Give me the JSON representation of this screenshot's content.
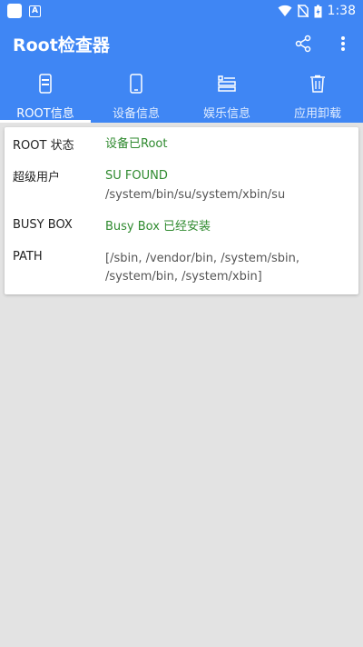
{
  "status_bar": {
    "time": "1:38"
  },
  "app": {
    "title": "Root检查器"
  },
  "tabs": [
    {
      "label": "ROOT信息"
    },
    {
      "label": "设备信息"
    },
    {
      "label": "娱乐信息"
    },
    {
      "label": "应用卸载"
    }
  ],
  "info": {
    "root_status": {
      "label": "ROOT 状态",
      "value": "设备已Root"
    },
    "superuser": {
      "label": "超级用户",
      "value": "SU FOUND",
      "path": "/system/bin/su/system/xbin/su"
    },
    "busybox": {
      "label": "BUSY BOX",
      "value": "Busy Box 已经安装"
    },
    "path": {
      "label": "PATH",
      "value": "[/sbin, /vendor/bin, /system/sbin, /system/bin, /system/xbin]"
    }
  },
  "colors": {
    "primary": "#3f86f4",
    "success": "#2f8a2f",
    "background": "#e3e3e3"
  }
}
